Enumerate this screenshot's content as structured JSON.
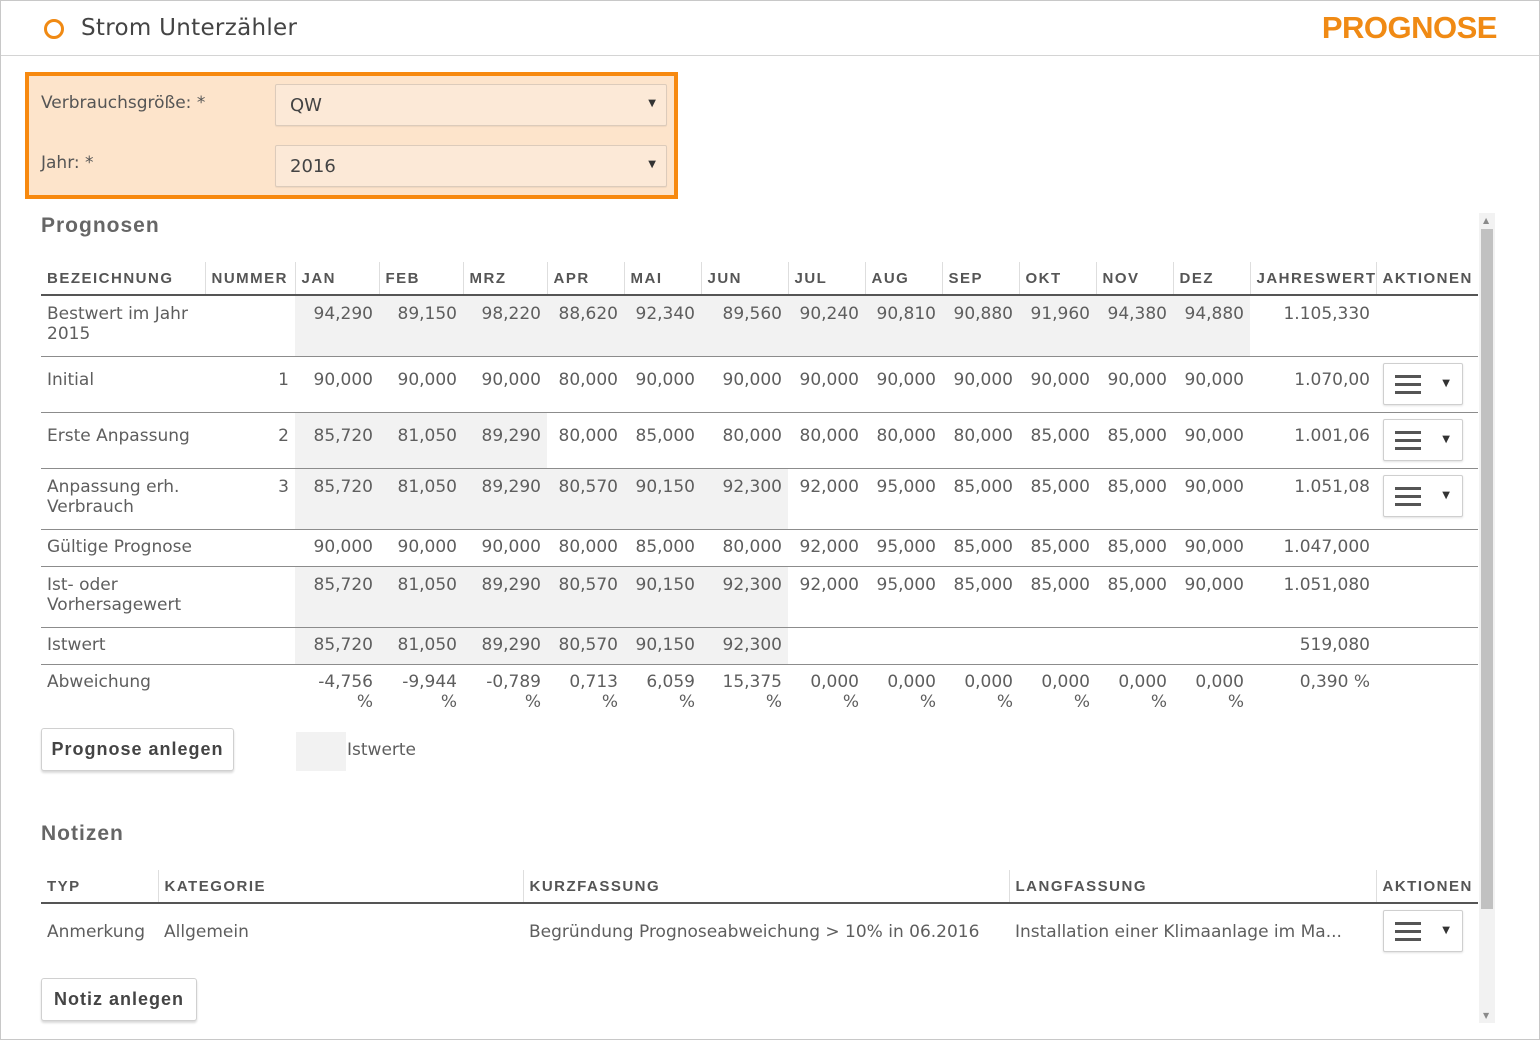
{
  "header": {
    "title": "Strom Unterzähler",
    "mode": "PROGNOSE"
  },
  "filter": {
    "verbrauch_label": "Verbrauchsgröße: *",
    "verbrauch_value": "QW",
    "jahr_label": "Jahr: *",
    "jahr_value": "2016"
  },
  "prognosen": {
    "title": "Prognosen",
    "columns": [
      "BEZEICHNUNG",
      "NUMMER",
      "JAN",
      "FEB",
      "MRZ",
      "APR",
      "MAI",
      "JUN",
      "JUL",
      "AUG",
      "SEP",
      "OKT",
      "NOV",
      "DEZ",
      "JAHRESWERT",
      "AKTIONEN"
    ],
    "rows": [
      {
        "name": "Bestwert im Jahr 2015",
        "nummer": "",
        "values": [
          "94,290",
          "89,150",
          "98,220",
          "88,620",
          "92,340",
          "89,560",
          "90,240",
          "90,810",
          "90,880",
          "91,960",
          "94,380",
          "94,880"
        ],
        "total": "1.105,330"
      },
      {
        "name": "Initial",
        "nummer": "1",
        "values": [
          "90,000",
          "90,000",
          "90,000",
          "80,000",
          "90,000",
          "90,000",
          "90,000",
          "90,000",
          "90,000",
          "90,000",
          "90,000",
          "90,000"
        ],
        "total": "1.070,00"
      },
      {
        "name": "Erste Anpassung",
        "nummer": "2",
        "values": [
          "85,720",
          "81,050",
          "89,290",
          "80,000",
          "85,000",
          "80,000",
          "80,000",
          "80,000",
          "80,000",
          "85,000",
          "85,000",
          "90,000"
        ],
        "total": "1.001,06"
      },
      {
        "name": "Anpassung erh. Verbrauch",
        "nummer": "3",
        "values": [
          "85,720",
          "81,050",
          "89,290",
          "80,570",
          "90,150",
          "92,300",
          "92,000",
          "95,000",
          "85,000",
          "85,000",
          "85,000",
          "90,000"
        ],
        "total": "1.051,08"
      },
      {
        "name": "Gültige Prognose",
        "nummer": "",
        "values": [
          "90,000",
          "90,000",
          "90,000",
          "80,000",
          "85,000",
          "80,000",
          "92,000",
          "95,000",
          "85,000",
          "85,000",
          "85,000",
          "90,000"
        ],
        "total": "1.047,000"
      },
      {
        "name": "Ist- oder Vorhersagewert",
        "nummer": "",
        "values": [
          "85,720",
          "81,050",
          "89,290",
          "80,570",
          "90,150",
          "92,300",
          "92,000",
          "95,000",
          "85,000",
          "85,000",
          "85,000",
          "90,000"
        ],
        "total": "1.051,080"
      },
      {
        "name": "Istwert",
        "nummer": "",
        "values": [
          "85,720",
          "81,050",
          "89,290",
          "80,570",
          "90,150",
          "92,300",
          "",
          "",
          "",
          "",
          "",
          ""
        ],
        "total": "519,080"
      },
      {
        "name": "Abweichung",
        "nummer": "",
        "values": [
          "-4,756 %",
          "-9,944 %",
          "-0,789 %",
          "0,713 %",
          "6,059 %",
          "15,375 %",
          "0,000 %",
          "0,000 %",
          "0,000 %",
          "0,000 %",
          "0,000 %",
          "0,000 %"
        ],
        "total": "0,390 %"
      }
    ],
    "add_button": "Prognose anlegen",
    "legend_label": "Istwerte"
  },
  "notizen": {
    "title": "Notizen",
    "columns": [
      "TYP",
      "KATEGORIE",
      "KURZFASSUNG",
      "LANGFASSUNG",
      "AKTIONEN"
    ],
    "rows": [
      {
        "typ": "Anmerkung",
        "kategorie": "Allgemein",
        "kurz": "Begründung Prognoseabweichung > 10% in 06.2016",
        "lang": "Installation einer Klimaanlage im Ma..."
      }
    ],
    "add_button": "Notiz anlegen"
  },
  "colors": {
    "accent": "#f08a14",
    "filter_bg": "#fde4cb",
    "istwert_bg": "#f2f2f2"
  },
  "icons": {
    "status": "ring-icon",
    "menu": "hamburger-icon",
    "dropdown": "caret-down-icon"
  }
}
